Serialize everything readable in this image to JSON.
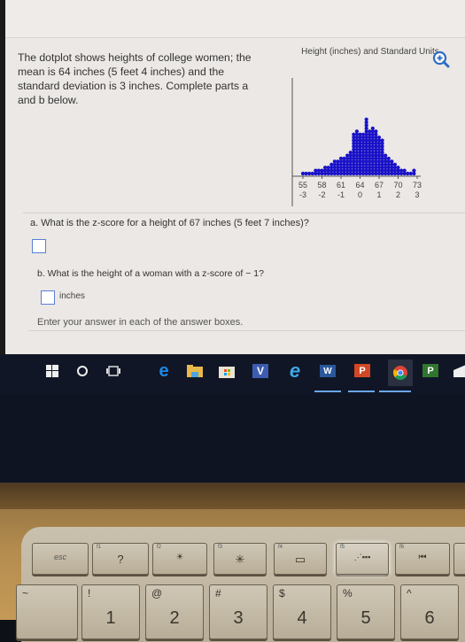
{
  "problem": {
    "intro": "The dotplot shows heights of college women; the mean is 64 inches (5 feet 4 inches) and the standard deviation is 3 inches. Complete parts a and b below.",
    "zoom_icon": "zoom-in-icon"
  },
  "chart_data": {
    "type": "dotplot",
    "title": "Height (inches) and Standard Units",
    "x_ticks": [
      55,
      58,
      61,
      64,
      67,
      70,
      73
    ],
    "z_ticks": [
      "-3",
      "-2",
      "-1",
      "0",
      "1",
      "2",
      "3"
    ],
    "xlim": [
      55,
      73
    ],
    "mean": 64,
    "sd": 3,
    "dot_color": "#1a12c8",
    "columns": [
      {
        "x": 55.0,
        "count": 1
      },
      {
        "x": 55.5,
        "count": 1
      },
      {
        "x": 56.0,
        "count": 1
      },
      {
        "x": 56.5,
        "count": 1
      },
      {
        "x": 57.0,
        "count": 2
      },
      {
        "x": 57.5,
        "count": 2
      },
      {
        "x": 58.0,
        "count": 2
      },
      {
        "x": 58.5,
        "count": 3
      },
      {
        "x": 59.0,
        "count": 3
      },
      {
        "x": 59.5,
        "count": 4
      },
      {
        "x": 60.0,
        "count": 5
      },
      {
        "x": 60.5,
        "count": 5
      },
      {
        "x": 61.0,
        "count": 6
      },
      {
        "x": 61.5,
        "count": 6
      },
      {
        "x": 62.0,
        "count": 7
      },
      {
        "x": 62.5,
        "count": 8
      },
      {
        "x": 63.0,
        "count": 14
      },
      {
        "x": 63.5,
        "count": 15
      },
      {
        "x": 64.0,
        "count": 14
      },
      {
        "x": 64.5,
        "count": 14
      },
      {
        "x": 65.0,
        "count": 19
      },
      {
        "x": 65.5,
        "count": 15
      },
      {
        "x": 66.0,
        "count": 16
      },
      {
        "x": 66.5,
        "count": 15
      },
      {
        "x": 67.0,
        "count": 13
      },
      {
        "x": 67.5,
        "count": 12
      },
      {
        "x": 68.0,
        "count": 7
      },
      {
        "x": 68.5,
        "count": 6
      },
      {
        "x": 69.0,
        "count": 5
      },
      {
        "x": 69.5,
        "count": 4
      },
      {
        "x": 70.0,
        "count": 3
      },
      {
        "x": 70.5,
        "count": 2
      },
      {
        "x": 71.0,
        "count": 2
      },
      {
        "x": 71.5,
        "count": 1
      },
      {
        "x": 72.0,
        "count": 1
      },
      {
        "x": 72.5,
        "count": 2
      }
    ]
  },
  "questions": {
    "a": {
      "label": "a. What is the z-score for a height of 67 inches (5 feet 7 inches)?",
      "answer": ""
    },
    "b": {
      "label": "b. What is the height of a woman with a z-score of  − 1?",
      "answer": "",
      "unit": "inches"
    },
    "instruction": "Enter your answer in each of the answer boxes."
  },
  "taskbar": {
    "items": [
      {
        "name": "start",
        "icon": "windows-logo-icon"
      },
      {
        "name": "cortana",
        "icon": "cortana-circle-icon"
      },
      {
        "name": "task-view",
        "icon": "task-view-icon"
      },
      {
        "name": "edge",
        "icon": "edge-icon",
        "letter": "e"
      },
      {
        "name": "file-explorer",
        "icon": "folder-icon"
      },
      {
        "name": "store",
        "icon": "store-icon"
      },
      {
        "name": "visio",
        "icon": "visio-icon",
        "letter": "V"
      },
      {
        "name": "internet-explorer",
        "icon": "ie-icon",
        "letter": "e"
      },
      {
        "name": "word",
        "icon": "word-icon",
        "letter": "W"
      },
      {
        "name": "powerpoint",
        "icon": "powerpoint-icon",
        "letter": "P"
      },
      {
        "name": "chrome",
        "icon": "chrome-icon"
      },
      {
        "name": "project",
        "icon": "project-icon",
        "letter": "P"
      },
      {
        "name": "mail",
        "icon": "mail-icon"
      }
    ]
  },
  "keyboard": {
    "fn_row": [
      {
        "label": "esc",
        "fn": ""
      },
      {
        "label": "?",
        "fn": "f1"
      },
      {
        "label": "☀",
        "fn": "f2"
      },
      {
        "label": "✳",
        "fn": "f3"
      },
      {
        "label": "▭",
        "fn": "f4"
      },
      {
        "label": "⋰▪▪▪",
        "fn": "f5"
      },
      {
        "label": "⏮",
        "fn": "f6"
      }
    ],
    "num_row": [
      {
        "sym": "~",
        "num": ""
      },
      {
        "sym": "!",
        "num": "1"
      },
      {
        "sym": "@",
        "num": "2"
      },
      {
        "sym": "#",
        "num": "3"
      },
      {
        "sym": "$",
        "num": "4"
      },
      {
        "sym": "%",
        "num": "5"
      },
      {
        "sym": "^",
        "num": "6"
      }
    ]
  }
}
